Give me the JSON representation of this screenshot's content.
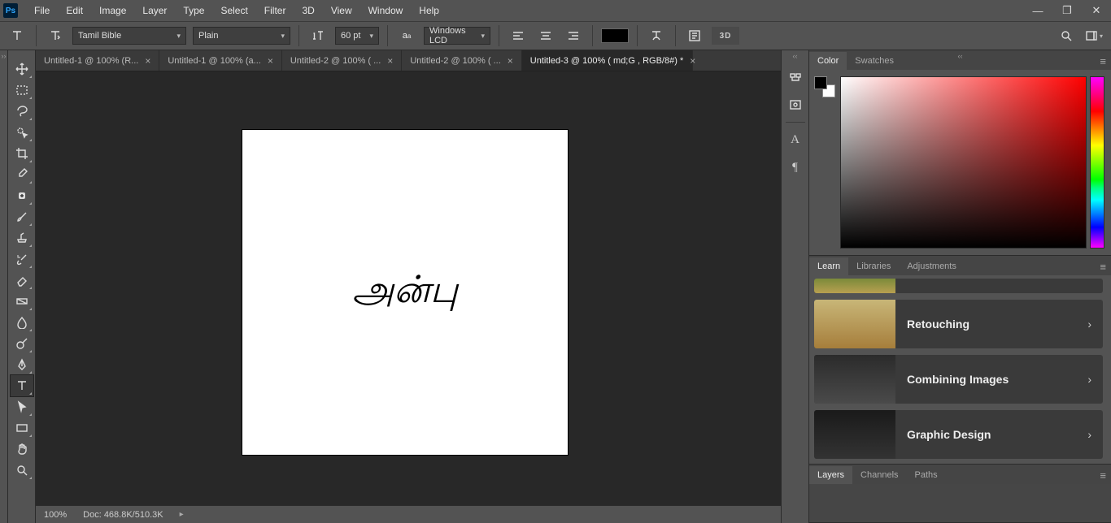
{
  "app_logo_text": "Ps",
  "menu": [
    "File",
    "Edit",
    "Image",
    "Layer",
    "Type",
    "Select",
    "Filter",
    "3D",
    "View",
    "Window",
    "Help"
  ],
  "options": {
    "font_family": "Tamil Bible",
    "font_style": "Plain",
    "font_size": "60 pt",
    "anti_alias": "Windows LCD",
    "btn_3d": "3D"
  },
  "document_tabs": [
    {
      "label": "Untitled-1 @ 100% (R...",
      "active": false
    },
    {
      "label": "Untitled-1 @ 100% (a...",
      "active": false
    },
    {
      "label": "Untitled-2 @ 100% (  ...",
      "active": false
    },
    {
      "label": "Untitled-2 @ 100% (  ...",
      "active": false
    },
    {
      "label": "Untitled-3 @ 100% (  md;G , RGB/8#) *",
      "active": true
    }
  ],
  "canvas_text": "அன்பு",
  "status": {
    "zoom": "100%",
    "doc_info": "Doc: 468.8K/510.3K"
  },
  "panels": {
    "color_tabs": [
      "Color",
      "Swatches"
    ],
    "learn_tabs": [
      "Learn",
      "Libraries",
      "Adjustments"
    ],
    "learn_items": [
      "Retouching",
      "Combining Images",
      "Graphic Design"
    ],
    "layers_tabs": [
      "Layers",
      "Channels",
      "Paths"
    ]
  }
}
